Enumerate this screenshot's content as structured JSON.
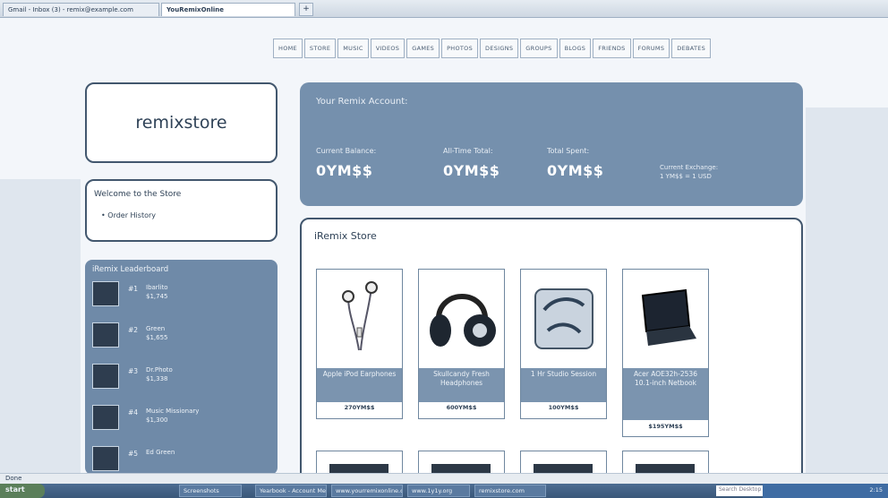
{
  "browser": {
    "tabs": [
      {
        "label": "Gmail - Inbox (3) - remix@example.com"
      },
      {
        "label": "YouRemixOnline"
      }
    ],
    "new_tab": "+"
  },
  "nav": {
    "items": [
      "HOME",
      "STORE",
      "MUSIC",
      "VIDEOS",
      "GAMES",
      "PHOTOS",
      "DESIGNS",
      "GROUPS",
      "BLOGS",
      "FRIENDS",
      "FORUMS",
      "DEBATES"
    ]
  },
  "sidebar": {
    "logo": "remixstore",
    "welcome_title": "Welcome to the Store",
    "order_history": "Order History",
    "leaderboard": {
      "title": "iRemix Leaderboard",
      "rows": [
        {
          "rank": "#1",
          "name": "Ibarlito",
          "amount": "$1,745"
        },
        {
          "rank": "#2",
          "name": "Green",
          "amount": "$1,655"
        },
        {
          "rank": "#3",
          "name": "Dr.Photo",
          "amount": "$1,338"
        },
        {
          "rank": "#4",
          "name": "Music Missionary",
          "amount": "$1,300"
        },
        {
          "rank": "#5",
          "name": "Ed Green",
          "amount": ""
        }
      ]
    }
  },
  "account": {
    "title": "Your Remix Account:",
    "current_balance_label": "Current Balance:",
    "current_balance": "0YM$$",
    "all_time_label": "All-Time Total:",
    "all_time": "0YM$$",
    "total_spent_label": "Total Spent:",
    "total_spent": "0YM$$",
    "exchange_note_1": "Current Exchange:",
    "exchange_note_2": "1 YM$$ = 1 USD"
  },
  "store": {
    "title": "iRemix Store",
    "products": [
      {
        "name": "Apple iPod Earphones",
        "price": "270YM$$"
      },
      {
        "name": "Skullcandy Fresh Headphones",
        "price": "600YM$$"
      },
      {
        "name": "1 Hr Studio Session",
        "price": "100YM$$"
      },
      {
        "name": "Acer AOE32h-2536 10.1-inch Netbook",
        "price": "$195YM$$"
      }
    ]
  },
  "status": {
    "text": "Done"
  },
  "taskbar": {
    "start": "start",
    "items": [
      "Screenshots",
      "Yearbook - Account Me...",
      "www.yourremixonline.c...",
      "www.1y1y.org",
      "remixstore.com"
    ],
    "search_placeholder": "Search Desktop",
    "clock": "2:15"
  }
}
